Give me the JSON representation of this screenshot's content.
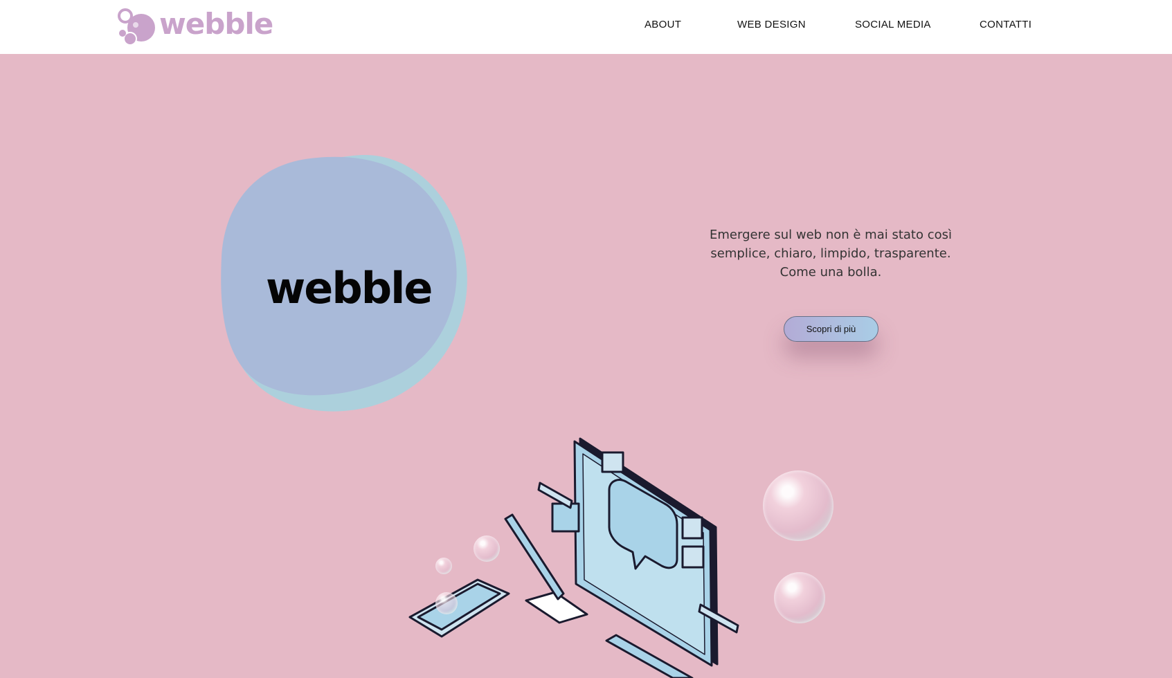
{
  "brand": {
    "logo_text": "webble",
    "hero_word": "webble",
    "logo_color": "#c9a3cb"
  },
  "nav": {
    "items": [
      {
        "label": "ABOUT"
      },
      {
        "label": "WEB DESIGN"
      },
      {
        "label": "SOCIAL MEDIA"
      },
      {
        "label": "CONTATTI"
      }
    ]
  },
  "hero": {
    "tagline_lines": [
      "Emergere sul web non è mai stato così",
      "semplice, chiaro, limpido, trasparente.",
      "Come una bolla."
    ],
    "cta_label": "Scopri di più"
  },
  "icons": {
    "logo": "bubbles-logo-icon",
    "illustration": "computer-social-illustration",
    "bubbles": "soap-bubble-icon"
  },
  "colors": {
    "background": "#e5b9c6",
    "header": "#ffffff",
    "blob": "#a9bad9",
    "blob_back": "#acd0dc",
    "illustration": "#a9d3e8",
    "outline": "#1a1a2e",
    "cta_gradient_start": "#b3abd6",
    "cta_gradient_end": "#a9cde6"
  }
}
